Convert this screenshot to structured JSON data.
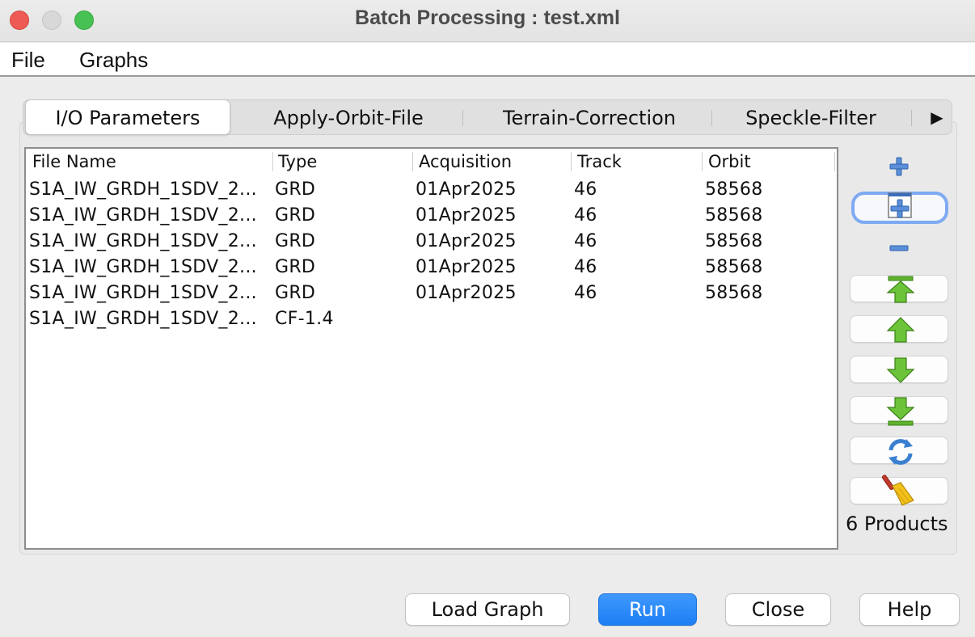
{
  "window": {
    "title": "Batch Processing : test.xml"
  },
  "menu": {
    "file": "File",
    "graphs": "Graphs"
  },
  "tabs": [
    {
      "label": "I/O Parameters",
      "active": true
    },
    {
      "label": "Apply-Orbit-File",
      "active": false
    },
    {
      "label": "Terrain-Correction",
      "active": false
    },
    {
      "label": "Speckle-Filter",
      "active": false
    }
  ],
  "table": {
    "columns": [
      "File Name",
      "Type",
      "Acquisition",
      "Track",
      "Orbit"
    ],
    "rows": [
      [
        "S1A_IW_GRDH_1SDV_2...",
        "GRD",
        "01Apr2025",
        "46",
        "58568"
      ],
      [
        "S1A_IW_GRDH_1SDV_2...",
        "GRD",
        "01Apr2025",
        "46",
        "58568"
      ],
      [
        "S1A_IW_GRDH_1SDV_2...",
        "GRD",
        "01Apr2025",
        "46",
        "58568"
      ],
      [
        "S1A_IW_GRDH_1SDV_2...",
        "GRD",
        "01Apr2025",
        "46",
        "58568"
      ],
      [
        "S1A_IW_GRDH_1SDV_2...",
        "GRD",
        "01Apr2025",
        "46",
        "58568"
      ],
      [
        "S1A_IW_GRDH_1SDV_2...",
        "CF-1.4",
        "",
        "",
        ""
      ]
    ]
  },
  "side_tools": [
    {
      "name": "add-product",
      "icon": "plus-icon"
    },
    {
      "name": "add-opened-products",
      "icon": "add-opened-icon"
    },
    {
      "name": "remove-product",
      "icon": "minus-icon"
    },
    {
      "name": "move-top",
      "icon": "arrow-top-icon"
    },
    {
      "name": "move-up",
      "icon": "arrow-up-icon"
    },
    {
      "name": "move-down",
      "icon": "arrow-down-icon"
    },
    {
      "name": "move-bottom",
      "icon": "arrow-bottom-icon"
    },
    {
      "name": "refresh",
      "icon": "refresh-icon"
    },
    {
      "name": "clear",
      "icon": "broom-icon"
    }
  ],
  "status": {
    "product_count": "6 Products"
  },
  "buttons": {
    "load_graph": "Load Graph",
    "run": "Run",
    "close": "Close",
    "help": "Help"
  },
  "colors": {
    "accent": "#1d7ff5",
    "arrow_green": "#5fb32e",
    "selection_ring": "#6fa0f0"
  }
}
